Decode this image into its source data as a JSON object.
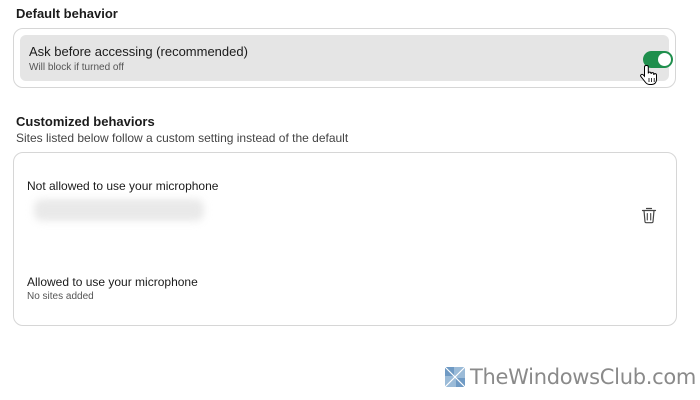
{
  "default_behavior": {
    "heading": "Default behavior",
    "setting": {
      "title": "Ask before accessing (recommended)",
      "description": "Will block if turned off",
      "toggle_on": true,
      "accent_color": "#1f8f4d"
    }
  },
  "customized_behaviors": {
    "heading": "Customized behaviors",
    "description": "Sites listed below follow a custom setting instead of the default",
    "not_allowed": {
      "label": "Not allowed to use your microphone",
      "entries": [
        "(blurred site)"
      ],
      "delete_icon": "trash-icon"
    },
    "allowed": {
      "label": "Allowed to use your microphone",
      "empty_text": "No sites added"
    }
  },
  "watermark": {
    "text": "TheWindowsClub.com"
  }
}
